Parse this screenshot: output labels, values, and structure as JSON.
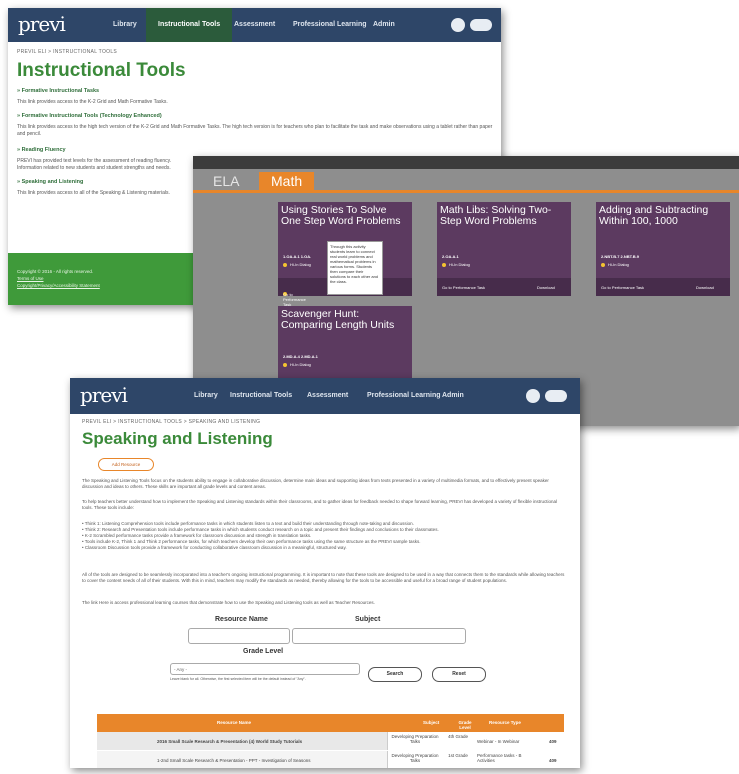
{
  "colors": {
    "nav": "#2e4668",
    "green": "#3b8a3a",
    "orange": "#e8862a",
    "purple": "#5c3a60"
  },
  "s1": {
    "logo": "previ",
    "nav": [
      "Library",
      "Instructional Tools",
      "Assessment",
      "Professional Learning",
      "Admin"
    ],
    "breadcrumb": "PREVIL ELI > INSTRUCTIONAL TOOLS",
    "title": "Instructional Tools",
    "sections": [
      {
        "title": "» Formative Instructional Tasks",
        "text": "This link provides access to the K-2 Grid and Math Formative Tasks."
      },
      {
        "title": "» Formative Instructional Tools (Technology Enhanced)",
        "text": "This link provides access to the high tech version of the K-2 Grid and Math Formative Tasks. The high tech version is for teachers who plan to facilitate the task and make observations using a tablet rather than paper and pencil."
      },
      {
        "title": "» Reading Fluency",
        "text": "PREVI has provided text levels for the assessment of reading fluency. Information related to new students and student strengths and needs."
      },
      {
        "title": "» Speaking and Listening",
        "text": "This link provides access to all of the Speaking & Listening materials."
      }
    ],
    "footer": [
      "Copyright © 2016 - All rights reserved.",
      "Terms of Use",
      "Copyright/Privacy/Accessibility Statement"
    ]
  },
  "s2": {
    "tabs": [
      "ELA",
      "Math"
    ],
    "cards": [
      {
        "title": "Using Stories To Solve One Step Word Problems",
        "std": "1.OA.A.1   1.OA.",
        "level": "Hi-In Dialog",
        "btn": "Go to Performance Task"
      },
      {
        "title": "Math Libs: Solving Two-Step Word Problems",
        "std": "2.OA.A.1",
        "level": "Hi-In Dialog",
        "btn": "Go to Performance Task",
        "dl": "Download"
      },
      {
        "title": "Adding and Subtracting Within 100, 1000",
        "std": "2.NBT.B.7   2.NBT.B.9",
        "level": "Hi-In Dialog",
        "btn": "Go to Performance Task",
        "dl": "Download"
      },
      {
        "title": "Scavenger Hunt: Comparing Length Units",
        "std": "2.MD.A.4   2.MD.A.1",
        "level": "Hi-In Dialog"
      }
    ],
    "tooltip": "Through this activity students learn to connect real world problems and mathematical problems in various forms. Students then compare their solutions to each other and the class."
  },
  "s3": {
    "logo": "previ",
    "nav": [
      "Library",
      "Instructional Tools",
      "Assessment",
      "Professional Learning",
      "Admin"
    ],
    "breadcrumb": "PREVIL ELI > INSTRUCTIONAL TOOLS > SPEAKING AND LISTENING",
    "title": "Speaking and Listening",
    "add_btn": "Add Resource",
    "paras": [
      "The Speaking and Listening Tools focus on the students ability to engage in collaborative discussion, determine main ideas and supporting ideas from texts presented in a variety of multimedia formats, and to effectively present speaker discussion and ideas to others. These skills are important all grade levels and content areas.",
      "To help teachers better understand how to implement the Speaking and Listening standards within their classrooms, and to gather ideas for feedback needed to shape forward learning, PREVI has developed a variety of flexible instructional tools. These tools include:",
      "• Think 1: Listening Comprehension tools include performance tasks in which students listen to a text and build their understanding through note-taking and discussion.\n• Think 2: Research and Presentation tools include performance tasks in which students conduct research on a topic and present their findings and conclusions to their classmates.\n• K-2 Scrambled performance tasks provide a framework for classroom discussion and strength in translation tasks.\n• Tools include K-2, Think 1 and Think 2 performance tasks, for which teachers develop their own performance tasks using the same structure as the PREVI sample tasks.\n• Classroom Discussion tools provide a framework for conducting collaborative classroom discussion in a meaningful, structured way.",
      "All of the tools are designed to be seamlessly incorporated into a teacher's ongoing instructional programming. It is important to note that these tools are designed to be used in a way that connects them to the standards while allowing teachers to cover the content needs of all of their students. With this in mind, teachers may modify the standards as needed, thereby allowing for the tools to be accessible and useful for a broad range of student populations.",
      "The link Here is access professional learning courses that demonstrate how to use the Speaking and Listening tools as well as Teacher Resources."
    ],
    "search": {
      "resource_label": "Resource Name",
      "subject_label": "Subject",
      "grade_label": "Grade Level",
      "grade_value": "- Any -",
      "hint": "Leave blank for all. Otherwise, the first selected item will be the default instead of \"Any\".",
      "search_btn": "Search",
      "reset_btn": "Reset"
    },
    "table": {
      "headers": [
        "Resource Name",
        "Subject",
        "Grade Level",
        "Resource Type"
      ],
      "rows": [
        {
          "name": "2016 Small Scale Research & Presentation (4) World Study Tutorials",
          "subject": "Developing Preparation Talks",
          "grade": "4th Grade",
          "type": "Webinar - In Webinar",
          "n": "409"
        },
        {
          "name": "1-2nd Small Scale Research & Presentation - PPT - Investigation of Seasons",
          "subject": "Developing Preparation Talks",
          "grade": "1st Grade",
          "type": "Performance tasks - B Activities",
          "n": "409"
        }
      ]
    }
  }
}
